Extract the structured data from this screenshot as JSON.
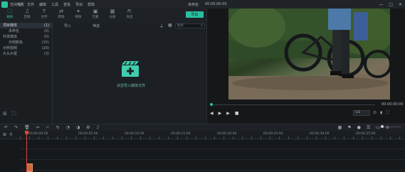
{
  "titlebar": {
    "app_name": "万兴喵影",
    "menu": [
      "文件",
      "编辑",
      "工具",
      "查看",
      "导出",
      "帮助"
    ],
    "project": "未命名",
    "time": "00:00:00:00"
  },
  "toolbar": {
    "tools": [
      {
        "icon": "folder-icon",
        "glyph": "🗀",
        "label": "媒体"
      },
      {
        "icon": "music-icon",
        "glyph": "♫",
        "label": "音频"
      },
      {
        "icon": "text-icon",
        "glyph": "T",
        "label": "文字"
      },
      {
        "icon": "transition-icon",
        "glyph": "⇄",
        "label": "转场"
      },
      {
        "icon": "effects-icon",
        "glyph": "✦",
        "label": "特效"
      },
      {
        "icon": "elements-icon",
        "glyph": "▣",
        "label": "元素"
      },
      {
        "icon": "split-screen-icon",
        "glyph": "▦",
        "label": "分屏"
      },
      {
        "icon": "export-icon",
        "glyph": "⇱",
        "label": "导出"
      }
    ],
    "export_label": "导出"
  },
  "library": {
    "items": [
      {
        "label": "项目媒体",
        "count": "(1)",
        "selected": true,
        "indent": false
      },
      {
        "label": "未命名",
        "count": "(0)",
        "selected": false,
        "indent": true
      },
      {
        "label": "共享媒体",
        "count": "(0)",
        "selected": false,
        "indent": false
      },
      {
        "label": "示例颜色",
        "count": "(15)",
        "selected": false,
        "indent": true
      },
      {
        "label": "示例视频",
        "count": "(20)",
        "selected": false,
        "indent": false
      },
      {
        "label": "片头片尾",
        "count": "(3)",
        "selected": false,
        "indent": false
      }
    ]
  },
  "media": {
    "import_label": "导入",
    "filter_label": "筛选",
    "search_placeholder": "搜索",
    "import_hint": "点击导入媒体文件"
  },
  "preview": {
    "time_right": "00:00:00:00",
    "quality": "1/2"
  },
  "timeline": {
    "ruler_labels": [
      "00:00:00:00",
      "00:00:05:00",
      "00:00:10:00",
      "00:00:15:00",
      "00:00:20:00",
      "00:00:25:00",
      "00:00:30:00",
      "00:00:35:00",
      "00:00:40:00",
      "00:00:45:00"
    ]
  }
}
